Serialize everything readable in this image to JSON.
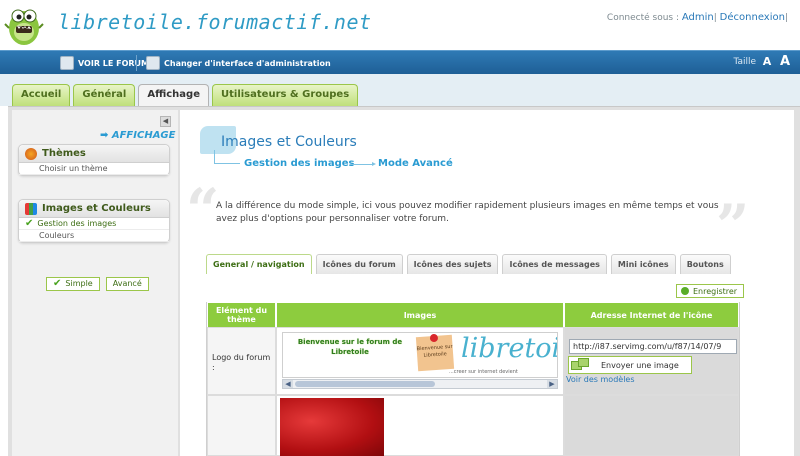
{
  "header": {
    "site_title": "libretoile.forumactif.net",
    "connected_label": "Connecté sous :",
    "user": "Admin",
    "separator": "|",
    "logout": "Déconnexion",
    "separator_end": "|"
  },
  "topbar": {
    "view_forum": "VOIR LE FORUM",
    "change_interface": "Changer d'interface d'administration",
    "size_label": "Taille"
  },
  "main_tabs": [
    {
      "label": "Accueil"
    },
    {
      "label": "Général"
    },
    {
      "label": "Affichage",
      "active": true
    },
    {
      "label": "Utilisateurs & Groupes"
    }
  ],
  "sidebar": {
    "section_title": "➡ AFFICHAGE",
    "panels": [
      {
        "title": "Thèmes",
        "items": [
          "Choisir un thème"
        ]
      },
      {
        "title": "Images et Couleurs",
        "items": [
          "Gestion des images",
          "Couleurs"
        ],
        "current": 0
      }
    ],
    "mode_simple": "Simple",
    "mode_advanced": "Avancé"
  },
  "page": {
    "title": "Images et Couleurs",
    "crumb_1": "Gestion des images",
    "crumb_2": "Mode Avancé",
    "quote_open": "“",
    "quote_close": "”",
    "description": "A la différence du mode simple, ici vous pouvez modifier rapidement plusieurs images en même temps et vous avez plus d'options pour personnaliser votre forum."
  },
  "sub_tabs": [
    {
      "label": "General / navigation",
      "active": true
    },
    {
      "label": "Icônes du forum"
    },
    {
      "label": "Icônes des sujets"
    },
    {
      "label": "Icônes de messages"
    },
    {
      "label": "Mini icônes"
    },
    {
      "label": "Boutons"
    }
  ],
  "save_label": "Enregistrer",
  "table": {
    "headers": [
      "Elément du thème",
      "Images",
      "Adresse Internet de l'icône"
    ],
    "row1_label": "Logo du forum :",
    "url_value": "http://i87.servimg.com/u/f87/14/07/9",
    "send_label": "Envoyer une image",
    "models_link": "Voir des modèles"
  },
  "banner": {
    "welcome": "Bienvenue sur le forum de Libretoile",
    "note": "Bienvenue sur Libretoile",
    "brand": "libretoi",
    "tagline": "...creer sur internet devient"
  },
  "colors": {
    "accent_blue": "#2f9bc5",
    "topbar": "#2f7ab5",
    "tab_green": "#bfe07a",
    "header_green": "#8dcc3e"
  }
}
